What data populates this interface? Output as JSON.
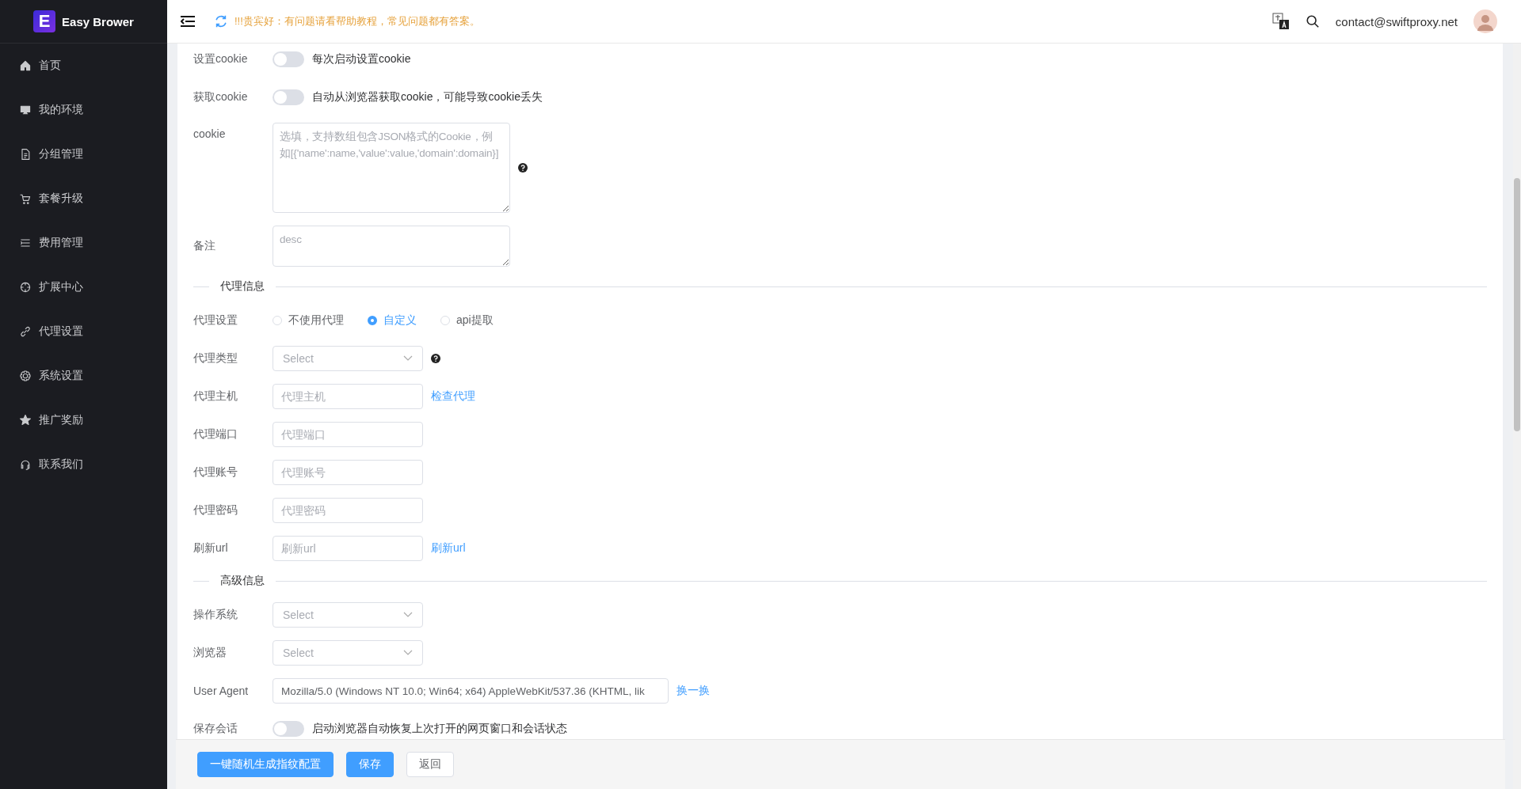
{
  "sidebar": {
    "logo_letter": "E",
    "brand": "Easy Brower",
    "items": [
      {
        "label": "首页"
      },
      {
        "label": "我的环境"
      },
      {
        "label": "分组管理"
      },
      {
        "label": "套餐升级"
      },
      {
        "label": "费用管理"
      },
      {
        "label": "扩展中心"
      },
      {
        "label": "代理设置"
      },
      {
        "label": "系统设置"
      },
      {
        "label": "推广奖励"
      },
      {
        "label": "联系我们"
      }
    ]
  },
  "header": {
    "notice": "!!!贵宾好：有问题请看帮助教程，常见问题都有答案。",
    "account": "contact@swiftproxy.net"
  },
  "form": [
    {
      "kind": "switch",
      "label": "设置cookie",
      "on": false,
      "text": "每次启动设置cookie"
    },
    {
      "kind": "switch",
      "label": "获取cookie",
      "on": false,
      "text": "自动从浏览器获取cookie，可能导致cookie丢失"
    },
    {
      "kind": "textarea",
      "label": "cookie",
      "placeholder": "选填，支持数组包含JSON格式的Cookie，例如[{'name':name,'value':value,'domain':domain}]",
      "help": true
    },
    {
      "kind": "memo",
      "label": "备注",
      "placeholder": "desc",
      "help": false
    },
    {
      "kind": "section",
      "title": "代理信息"
    },
    {
      "kind": "radio",
      "label": "代理设置",
      "options": [
        {
          "label": "不使用代理",
          "selected": false
        },
        {
          "label": "自定义",
          "selected": true
        },
        {
          "label": "api提取",
          "selected": false
        }
      ]
    },
    {
      "kind": "select",
      "label": "代理类型",
      "placeholder": "Select",
      "help": true
    },
    {
      "kind": "input",
      "label": "代理主机",
      "placeholder": "代理主机",
      "link": "检查代理"
    },
    {
      "kind": "input",
      "label": "代理端口",
      "placeholder": "代理端口"
    },
    {
      "kind": "input",
      "label": "代理账号",
      "placeholder": "代理账号"
    },
    {
      "kind": "input",
      "label": "代理密码",
      "placeholder": "代理密码"
    },
    {
      "kind": "input",
      "label": "刷新url",
      "placeholder": "刷新url",
      "link": "刷新url"
    },
    {
      "kind": "section",
      "title": "高级信息"
    },
    {
      "kind": "select",
      "label": "操作系统",
      "placeholder": "Select",
      "help": false
    },
    {
      "kind": "select",
      "label": "浏览器",
      "placeholder": "Select",
      "help": false
    },
    {
      "kind": "wide",
      "label": "User Agent",
      "value": "Mozilla/5.0 (Windows NT 10.0; Win64; x64) AppleWebKit/537.36 (KHTML, lik",
      "link": "换一换"
    },
    {
      "kind": "switch",
      "label": "保存会话",
      "on": false,
      "text": "启动浏览器自动恢复上次打开的网页窗口和会话状态"
    }
  ],
  "footer": {
    "buttons": [
      {
        "label": "一键随机生成指纹配置",
        "kind": "primary"
      },
      {
        "label": "保存",
        "kind": "primary"
      },
      {
        "label": "返回",
        "kind": "default"
      }
    ]
  }
}
